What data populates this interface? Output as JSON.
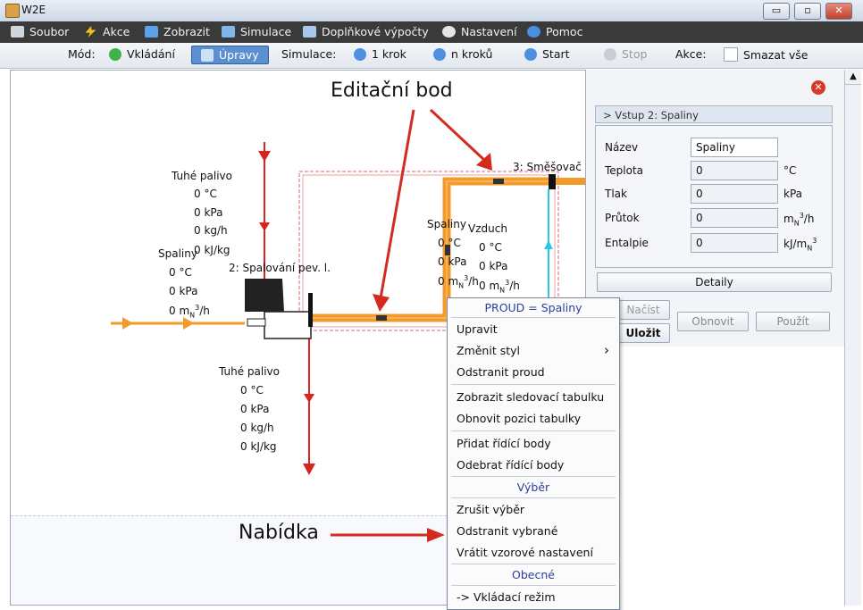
{
  "window": {
    "title": "W2E",
    "minimize": "▭",
    "maximize": "▫",
    "close": "✕"
  },
  "menubar": {
    "items": [
      {
        "label": "Soubor",
        "icon": "disk-icon"
      },
      {
        "label": "Akce",
        "icon": "lightning-icon"
      },
      {
        "label": "Zobrazit",
        "icon": "view-icon"
      },
      {
        "label": "Simulace",
        "icon": "monitor-icon"
      },
      {
        "label": "Doplňkové výpočty",
        "icon": "calc-icon"
      },
      {
        "label": "Nastavení",
        "icon": "gear-icon"
      },
      {
        "label": "Pomoc",
        "icon": "help-icon"
      }
    ]
  },
  "toolbar": {
    "mode_label": "Mód:",
    "insert_label": "Vkládání",
    "edit_label": "Úpravy",
    "simulation_label": "Simulace:",
    "step1_label": "1 krok",
    "stepn_label": "n kroků",
    "start_label": "Start",
    "stop_label": "Stop",
    "action_label": "Akce:",
    "clear_label": "Smazat vše"
  },
  "diagram": {
    "annotation_top": "Editační bod",
    "annotation_bottom": "Nabídka",
    "fuel_top": [
      "Tuhé palivo",
      "0 °C",
      "0 kPa",
      "0 kg/h",
      "0 kJ/kg"
    ],
    "flue_left": [
      "Spaliny",
      "0 °C",
      "0 kPa",
      "0 m",
      "N",
      "3",
      "/h"
    ],
    "combustor_label": "2: Spalování pev. l.",
    "fuel_bottom": [
      "Tuhé palivo",
      "0 °C",
      "0 kPa",
      "0 kg/h",
      "0 kJ/kg"
    ],
    "mixer_label": "3: Směšovač",
    "flue_mid": [
      "Spaliny",
      "0 °C",
      "0 kPa",
      "0 m",
      "N",
      "3",
      "/h"
    ],
    "air_mid": [
      "Vzduch",
      "0 °C",
      "0 kPa",
      "0 m",
      "N",
      "3",
      "/h"
    ]
  },
  "panel": {
    "close_icon": "✕",
    "header": "> Vstup 2: Spaliny",
    "fields": [
      {
        "label": "Název",
        "value": "Spaliny",
        "unit": ""
      },
      {
        "label": "Teplota",
        "value": "0",
        "unit": "°C"
      },
      {
        "label": "Tlak",
        "value": "0",
        "unit": "kPa"
      },
      {
        "label": "Průtok",
        "value": "0",
        "unit": "m_N^3/h"
      },
      {
        "label": "Entalpie",
        "value": "0",
        "unit": "kJ/m_N^3"
      }
    ],
    "unit_flow": [
      "m",
      "N",
      "3",
      "/h"
    ],
    "unit_enthalpy": [
      "kJ/m",
      "N",
      "3"
    ],
    "details_label": "Detaily",
    "load_label": "Načíst",
    "save_label": "Uložit",
    "refresh_label": "Obnovit",
    "apply_label": "Použít"
  },
  "context_menu": {
    "header": "PROUD = Spaliny",
    "items_a": [
      "Upravit",
      "Změnit styl",
      "Odstranit proud"
    ],
    "submenu_arrow": "›",
    "items_b": [
      "Zobrazit sledovací tabulku",
      "Obnovit pozici tabulky"
    ],
    "items_c": [
      "Přidat řídící body",
      "Odebrat řídící body"
    ],
    "section_select": "Výběr",
    "items_d": [
      "Zrušit výběr",
      "Odstranit vybrané",
      "Vrátit vzorové nastavení"
    ],
    "section_general": "Obecné",
    "items_e": [
      "-> Vkládací režim"
    ]
  },
  "colors": {
    "stream_orange": "#f39a2a",
    "stream_red": "#d8231f",
    "stream_cyan": "#29c9e6",
    "accent_blue": "#5b8fd0"
  }
}
